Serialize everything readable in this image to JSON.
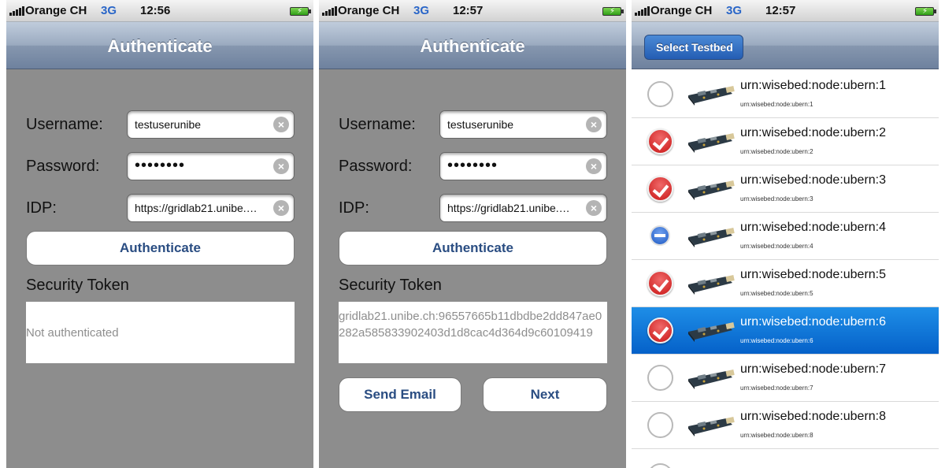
{
  "status_bar": {
    "carrier": "Orange CH",
    "network": "3G"
  },
  "screens": [
    {
      "time": "12:56",
      "title": "Authenticate",
      "username_label": "Username:",
      "username_value": "testuserunibe",
      "password_label": "Password:",
      "password_value": "••••••••",
      "idp_label": "IDP:",
      "idp_value": "https://gridlab21.unibe.…",
      "authenticate_button": "Authenticate",
      "token_label": "Security Token",
      "token_text": "Not authenticated"
    },
    {
      "time": "12:57",
      "title": "Authenticate",
      "username_label": "Username:",
      "username_value": "testuserunibe",
      "password_label": "Password:",
      "password_value": "••••••••",
      "idp_label": "IDP:",
      "idp_value": "https://gridlab21.unibe.…",
      "authenticate_button": "Authenticate",
      "token_label": "Security Token",
      "token_text": "gridlab21.unibe.ch:96557665b11dbdbe2dd847ae0282a585833902403d1d8cac4d364d9c60109419",
      "send_email_button": "Send Email",
      "next_button": "Next"
    },
    {
      "time": "12:57",
      "back_button": "Select Testbed",
      "nodes": [
        {
          "title": "urn:wisebed:node:ubern:1",
          "subtitle": "urn:wisebed:node:ubern:1",
          "state": "unchecked"
        },
        {
          "title": "urn:wisebed:node:ubern:2",
          "subtitle": "urn:wisebed:node:ubern:2",
          "state": "checked"
        },
        {
          "title": "urn:wisebed:node:ubern:3",
          "subtitle": "urn:wisebed:node:ubern:3",
          "state": "checked"
        },
        {
          "title": "urn:wisebed:node:ubern:4",
          "subtitle": "urn:wisebed:node:ubern:4",
          "state": "unavailable"
        },
        {
          "title": "urn:wisebed:node:ubern:5",
          "subtitle": "urn:wisebed:node:ubern:5",
          "state": "checked"
        },
        {
          "title": "urn:wisebed:node:ubern:6",
          "subtitle": "urn:wisebed:node:ubern:6",
          "state": "checked",
          "highlighted": true
        },
        {
          "title": "urn:wisebed:node:ubern:7",
          "subtitle": "urn:wisebed:node:ubern:7",
          "state": "unchecked"
        },
        {
          "title": "urn:wisebed:node:ubern:8",
          "subtitle": "urn:wisebed:node:ubern:8",
          "state": "unchecked"
        }
      ]
    }
  ],
  "colors": {
    "navbar": "#8697af",
    "background": "#8d8d8d",
    "button_text": "#2a4d82",
    "selection": "#0561c9",
    "check_red": "#c91515"
  }
}
